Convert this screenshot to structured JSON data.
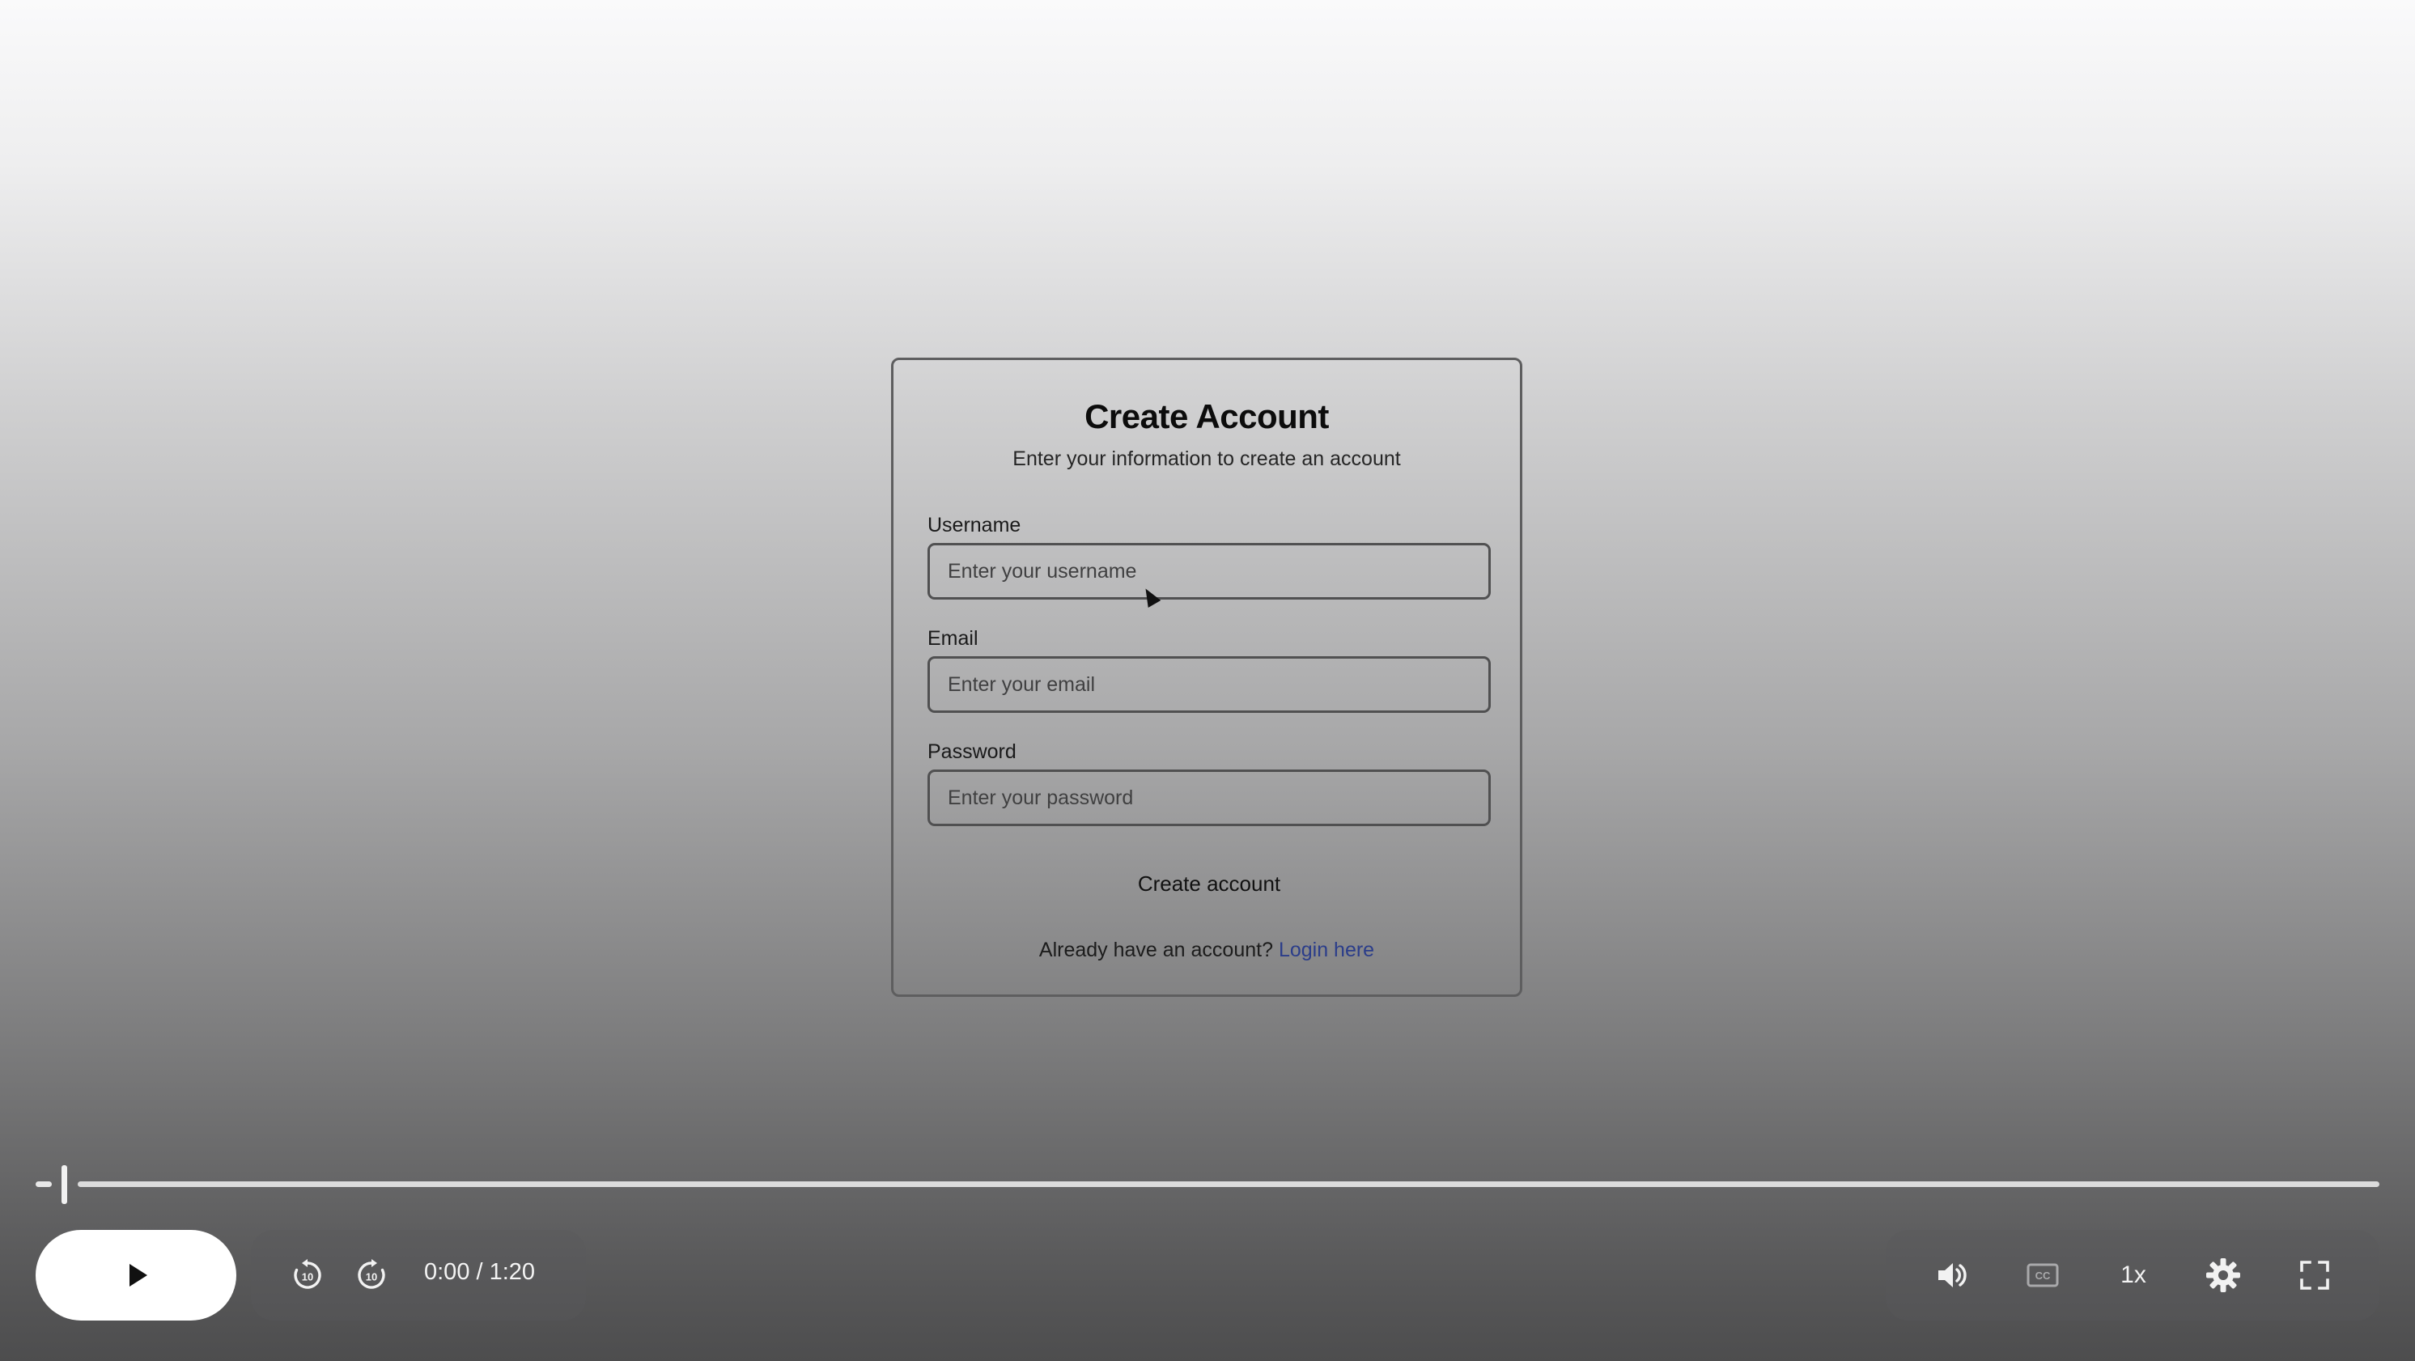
{
  "form": {
    "title": "Create Account",
    "subtitle": "Enter your information to create an account",
    "username_label": "Username",
    "username_placeholder": "Enter your username",
    "email_label": "Email",
    "email_placeholder": "Enter your email",
    "password_label": "Password",
    "password_placeholder": "Enter your password",
    "submit_label": "Create account",
    "login_prompt": "Already have an account?",
    "login_link": "Login here"
  },
  "player": {
    "time_display": "0:00 / 1:20",
    "progress_fraction": 0.0,
    "speed": "1x",
    "icons": {
      "play": "play-icon",
      "rewind": "rewind-10-icon",
      "forward": "forward-10-icon",
      "volume": "volume-icon",
      "captions": "captions-icon",
      "settings": "gear-icon",
      "fullscreen": "fullscreen-icon"
    }
  },
  "colors": {
    "link": "#2b3d8a",
    "control_text": "#f4f4f4",
    "play_button_bg": "#ffffff"
  }
}
